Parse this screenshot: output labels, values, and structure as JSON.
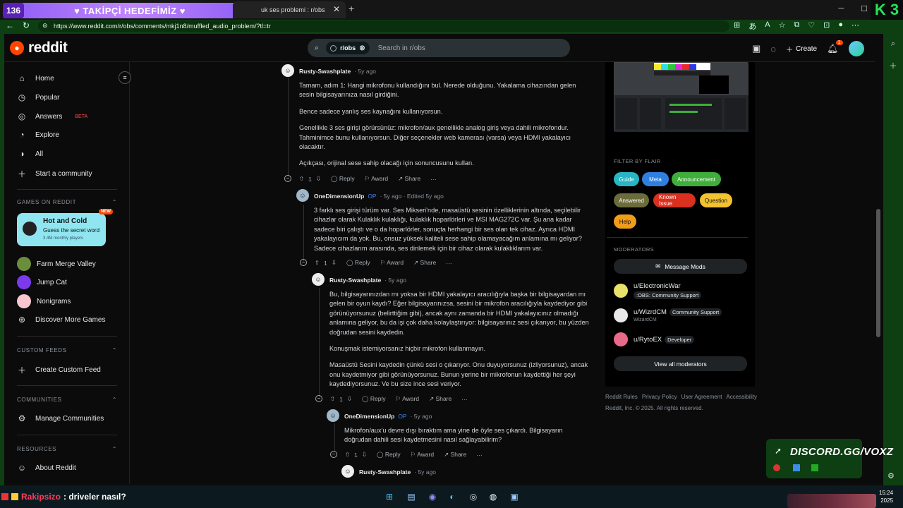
{
  "stream_overlay": {
    "left_counter": "136",
    "banner": "♥ TAKİPÇİ HEDEFİMİZ ♥",
    "right_counter": "150",
    "corner_logo": "K 3",
    "discord_text": "DISCORD.GG/VOXZ",
    "chat_user": "Rakipsizo",
    "chat_message": ": driveler nasıl?",
    "colors": {
      "stream_green": "#0e3f12",
      "banner_purple": "#8b5cf6"
    }
  },
  "browser": {
    "tab_title": "uk ses problemi : r/obs",
    "url": "https://www.reddit.com/r/obs/comments/mkj1n8/muffled_audio_problem/?tl=tr"
  },
  "header": {
    "logo": "reddit",
    "search_chip": "r/obs",
    "search_placeholder": "Search in r/obs",
    "create_label": "Create",
    "notification_count": "1",
    "brand_color": "#ff4500"
  },
  "sidebar": {
    "nav": [
      {
        "label": "Home",
        "icon": "home-icon"
      },
      {
        "label": "Popular",
        "icon": "popular-icon"
      },
      {
        "label": "Answers",
        "icon": "answers-icon",
        "badge": "BETA"
      },
      {
        "label": "Explore",
        "icon": "explore-icon"
      },
      {
        "label": "All",
        "icon": "all-icon"
      },
      {
        "label": "Start a community",
        "icon": "plus-icon"
      }
    ],
    "games_heading": "GAMES ON REDDIT",
    "promo": {
      "title": "Hot and Cold",
      "subtitle": "Guess the secret word",
      "meta": "3.4M monthly players",
      "badge": "NEW"
    },
    "games": [
      {
        "label": "Farm Merge Valley"
      },
      {
        "label": "Jump Cat"
      },
      {
        "label": "Nonigrams"
      },
      {
        "label": "Discover More Games"
      }
    ],
    "custom_feeds_heading": "CUSTOM FEEDS",
    "create_custom_feed": "Create Custom Feed",
    "communities_heading": "COMMUNITIES",
    "manage_communities": "Manage Communities",
    "resources_heading": "RESOURCES",
    "about_reddit": "About Reddit"
  },
  "comments": [
    {
      "user": "Rusty-Swashplate",
      "meta": "· 5y ago",
      "paragraphs": [
        "Tamam, adım 1: Hangi mikrofonu kullandığını bul. Nerede olduğunu. Yakalama cihazından gelen sesin bilgisayarınıza nasıl girdiğini.",
        "Bence sadece yanlış ses kaynağını kullanıyorsun.",
        "Genellikle 3 ses girişi görürsünüz: mikrofon/aux genellikle analog giriş veya dahili mikrofondur. Tahminimce bunu kullanıyorsun. Diğer seçenekler web kamerası (varsa) veya HDMI yakalayıcı olacaktır.",
        "Açıkçası, orijinal sese sahip olacağı için sonuncusunu kullan."
      ],
      "votes": "1"
    },
    {
      "user": "OneDimensionUp",
      "op": "OP",
      "meta": "· 5y ago · Edited 5y ago",
      "paragraphs": [
        "3 farklı ses girişi türüm var. Ses Mikseri'nde, masaüstü sesinin özelliklerinin altında, seçilebilir cihazlar olarak Kulaklık kulaklığı, kulaklık hoparlörleri ve MSI MAG272C var. Şu ana kadar sadece biri çalıştı ve o da hoparlörler, sonuçta herhangi bir ses olan tek cihaz. Ayrıca HDMI yakalayıcım da yok. Bu, onsuz yüksek kaliteli sese sahip olamayacağım anlamına mı geliyor? Sadece cihazlarım arasında, ses dinlemek için bir cihaz olarak kulaklıklarım var."
      ],
      "votes": "1"
    },
    {
      "user": "Rusty-Swashplate",
      "meta": "· 5y ago",
      "paragraphs": [
        "Bu, bilgisayarınızdan mı yoksa bir HDMI yakalayıcı aracılığıyla başka bir bilgisayardan mı gelen bir oyun kaydı? Eğer bilgisayarınızsa, sesini bir mikrofon aracılığıyla kaydediyor gibi görünüyorsunuz (belirttiğim gibi), ancak aynı zamanda bir HDMI yakalayıcınız olmadığı anlamına geliyor, bu da işi çok daha kolaylaştırıyor: bilgisayarınız sesi çıkarıyor, bu yüzden doğrudan sesini kaydedin.",
        "Konuşmak istemiyorsanız hiçbir mikrofon kullanmayın.",
        "Masaüstü Sesini kaydedin çünkü sesi o çıkarıyor. Onu duyuyorsunuz (izliyorsunuz), ancak onu kaydetmiyor gibi görünüyorsunuz. Bunun yerine bir mikrofonun kaydettiği her şeyi kaydediyorsunuz. Ve bu size ince sesi veriyor."
      ],
      "votes": "1"
    },
    {
      "user": "OneDimensionUp",
      "op": "OP",
      "meta": "· 5y ago",
      "paragraphs": [
        "Mikrofon/aux'u devre dışı bıraktım ama yine de öyle ses çıkardı. Bilgisayarın doğrudan dahili sesi kaydetmesini nasıl sağlayabilirim?"
      ],
      "votes": "1"
    },
    {
      "user": "Rusty-Swashplate",
      "meta": "· 5y ago",
      "paragraphs": [],
      "votes": ""
    }
  ],
  "actions": {
    "reply": "Reply",
    "award": "Award",
    "share": "Share",
    "more": "···"
  },
  "right_panel": {
    "flair_heading": "FILTER BY FLAIR",
    "flairs": [
      {
        "label": "Guide",
        "bg": "#29b6c4",
        "fg": "#ffffff"
      },
      {
        "label": "Meta",
        "bg": "#2f7fe0",
        "fg": "#ffffff"
      },
      {
        "label": "Announcement",
        "bg": "#3fae3a",
        "fg": "#ffffff"
      },
      {
        "label": "Answered",
        "bg": "#6b6b3b",
        "fg": "#ffffff"
      },
      {
        "label": "Known Issue",
        "bg": "#d9301f",
        "fg": "#ffffff"
      },
      {
        "label": "Question",
        "bg": "#f2c230",
        "fg": "#111111"
      },
      {
        "label": "Help",
        "bg": "#f29d1a",
        "fg": "#111111"
      }
    ],
    "moderators_heading": "MODERATORS",
    "message_mods": "Message Mods",
    "mods": [
      {
        "name": "u/ElectronicWar",
        "flair": ":OBS: Community Support",
        "sub": ""
      },
      {
        "name": "u/WizrdCM",
        "flair": "Community Support",
        "sub": "WizardCM"
      },
      {
        "name": "u/RytoEX",
        "flair": "Developer",
        "sub": ""
      }
    ],
    "view_all_mods": "View all moderators",
    "footer_links": [
      "Reddit Rules",
      "Privacy Policy",
      "User Agreement",
      "Accessibility"
    ],
    "copyright": "Reddit, Inc. © 2025. All rights reserved."
  },
  "taskbar": {
    "time": "15:24",
    "date": "2025"
  }
}
